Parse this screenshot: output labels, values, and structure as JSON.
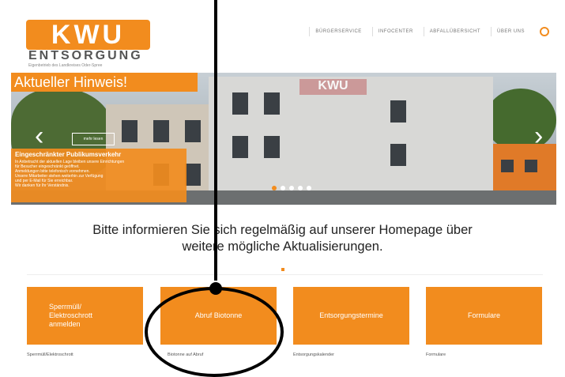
{
  "header": {
    "logo_mark": "KWU",
    "logo_text": "ENTSORGUNG",
    "logo_sub": "Eigenbetrieb des Landkreises Oder-Spree",
    "nav": [
      "BÜRGERSERVICE",
      "INFOCENTER",
      "ABFALLÜBERSICHT",
      "ÜBER UNS"
    ],
    "search_icon": "search-icon"
  },
  "slider": {
    "notice_title": "Aktueller Hinweis!",
    "sign_text": "KWU",
    "more_button": "mehr lesen",
    "notice_headline": "Eingeschränkter Publikumsverkehr",
    "notice_body": [
      "In Anbetracht der aktuellen Lage bleiben unsere Einrichtungen",
      "für Besucher eingeschränkt geöffnet.",
      "Anmeldungen bitte telefonisch vornehmen.",
      "Unsere Mitarbeiter stehen weiterhin zur Verfügung",
      "und per E-Mail für Sie erreichbar.",
      "Wir danken für Ihr Verständnis."
    ],
    "slide_count": 5,
    "active_slide": 1
  },
  "info_text": {
    "line1": "Bitte informieren Sie sich regelmäßig auf unserer Homepage über",
    "line2": "weitere mögliche Aktualisierungen."
  },
  "tiles": [
    {
      "label": "Sperrmüll/\nElektroschrott\nanmelden",
      "caption": "Sperrmüll/Elektroschrott"
    },
    {
      "label": "Abruf Biotonne",
      "caption": "Biotonne auf Abruf"
    },
    {
      "label": "Entsorgungstermine",
      "caption": "Entsorgungskalender"
    },
    {
      "label": "Formulare",
      "caption": "Formulare"
    }
  ],
  "colors": {
    "accent": "#f28c1e",
    "annotation": "#000000"
  }
}
